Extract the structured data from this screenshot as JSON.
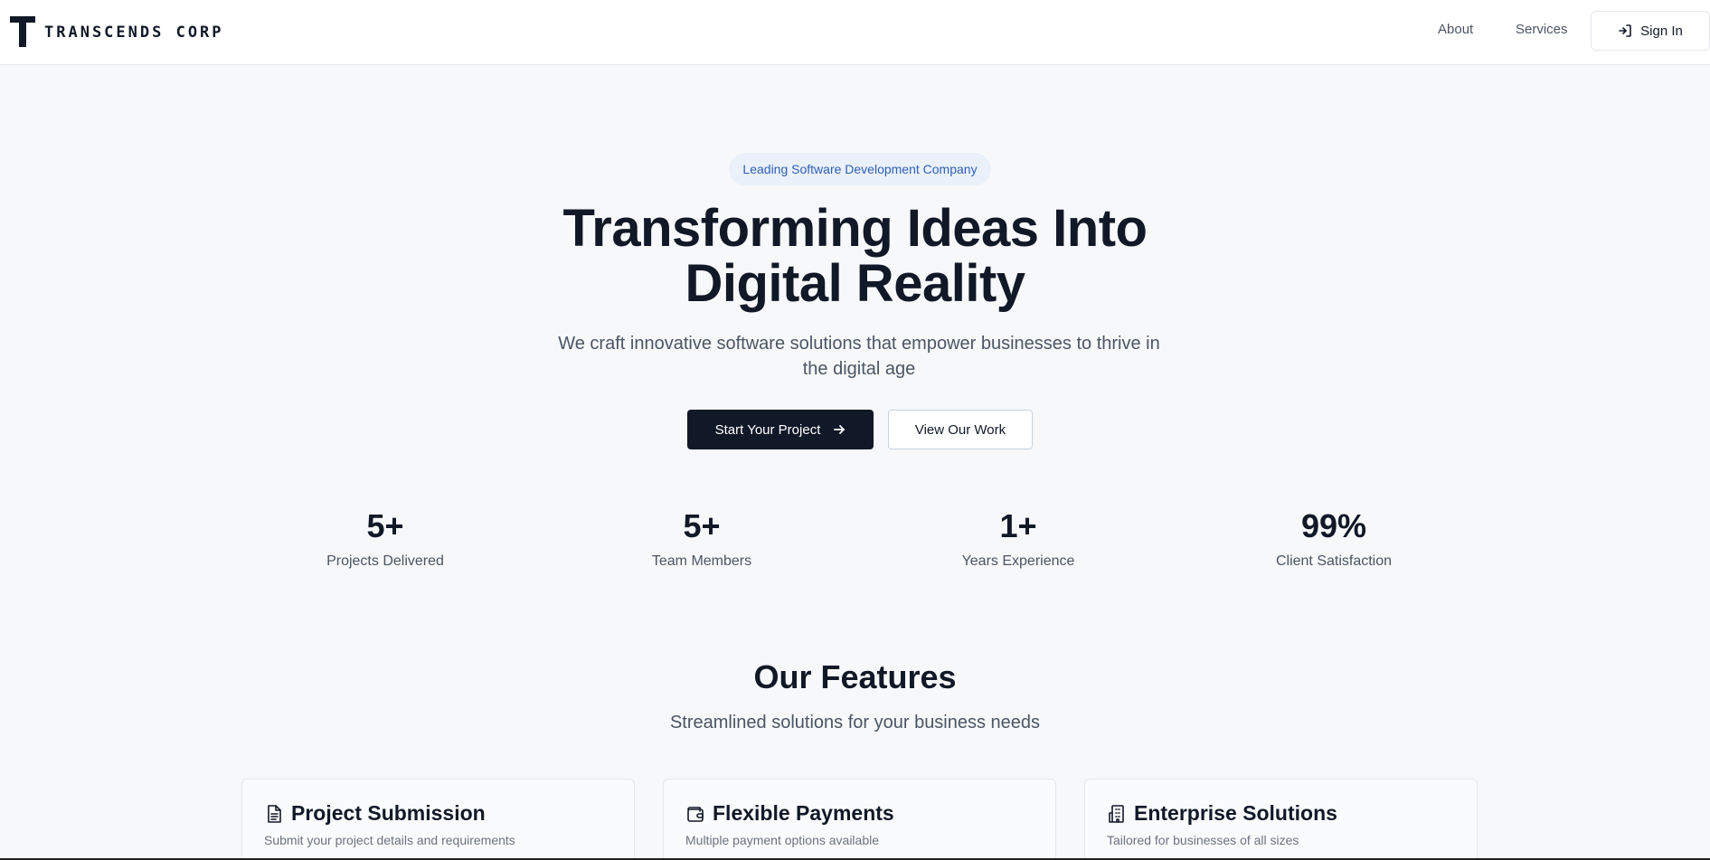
{
  "brand": {
    "name": "TRANSCENDS CORP",
    "logo_icon": "t-logo-icon"
  },
  "nav": {
    "about": "About",
    "services": "Services",
    "signin": "Sign In"
  },
  "hero": {
    "badge": "Leading Software Development Company",
    "title_line1": "Transforming Ideas Into",
    "title_line2": "Digital Reality",
    "subtitle_line1": "We craft innovative software solutions that empower businesses to thrive in",
    "subtitle_line2": "the digital age",
    "primary_cta": "Start Your Project",
    "secondary_cta": "View Our Work"
  },
  "stats": [
    {
      "value": "5+",
      "label": "Projects Delivered"
    },
    {
      "value": "5+",
      "label": "Team Members"
    },
    {
      "value": "1+",
      "label": "Years Experience"
    },
    {
      "value": "99%",
      "label": "Client Satisfaction"
    }
  ],
  "features": {
    "title": "Our Features",
    "subtitle": "Streamlined solutions for your business needs",
    "cards": [
      {
        "icon": "document-icon",
        "title": "Project Submission",
        "desc": "Submit your project details and requirements"
      },
      {
        "icon": "wallet-icon",
        "title": "Flexible Payments",
        "desc": "Multiple payment options available"
      },
      {
        "icon": "building-icon",
        "title": "Enterprise Solutions",
        "desc": "Tailored for businesses of all sizes"
      }
    ]
  },
  "colors": {
    "primary": "#111827",
    "badge_bg": "#eaf1fb",
    "badge_text": "#2f5fb3",
    "page_bg": "#f7f8fa"
  }
}
